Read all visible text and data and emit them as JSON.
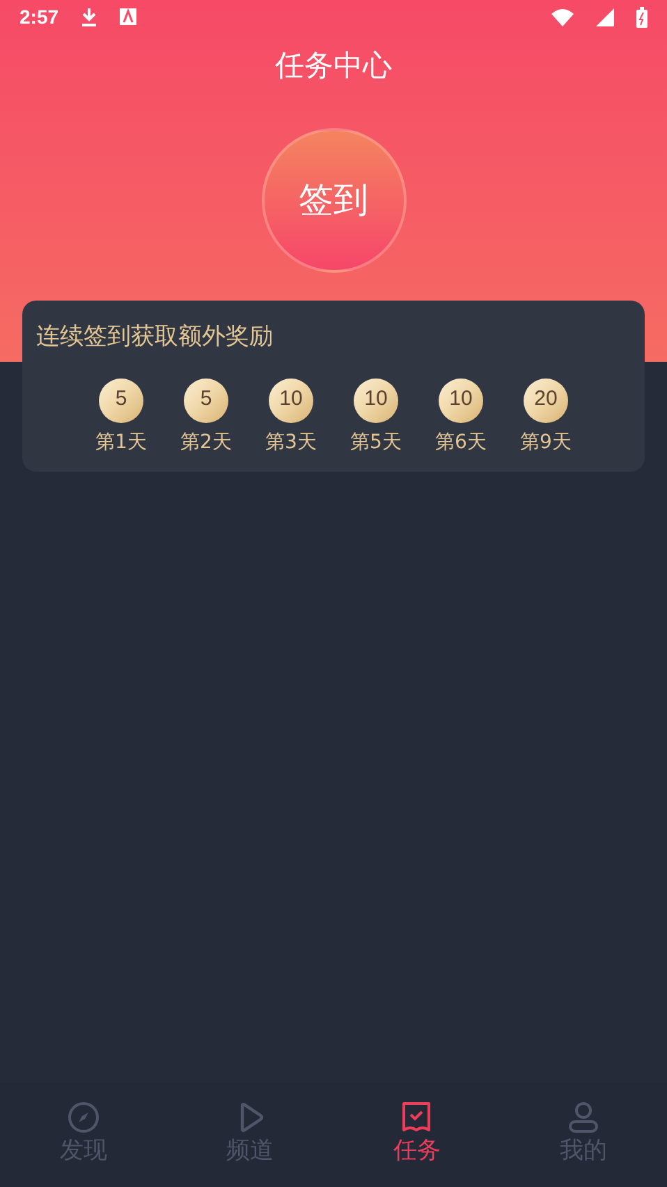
{
  "status_bar": {
    "time": "2:57"
  },
  "title": "任务中心",
  "sign_button": "签到",
  "streak_card": {
    "title": "连续签到获取额外奖励",
    "rewards": [
      {
        "points": "5",
        "day": "第1天"
      },
      {
        "points": "5",
        "day": "第2天"
      },
      {
        "points": "10",
        "day": "第3天"
      },
      {
        "points": "10",
        "day": "第5天"
      },
      {
        "points": "10",
        "day": "第6天"
      },
      {
        "points": "20",
        "day": "第9天"
      }
    ]
  },
  "bottom_nav": [
    {
      "label": "发现",
      "selected": false
    },
    {
      "label": "频道",
      "selected": false
    },
    {
      "label": "任务",
      "selected": true
    },
    {
      "label": "我的",
      "selected": false
    }
  ]
}
